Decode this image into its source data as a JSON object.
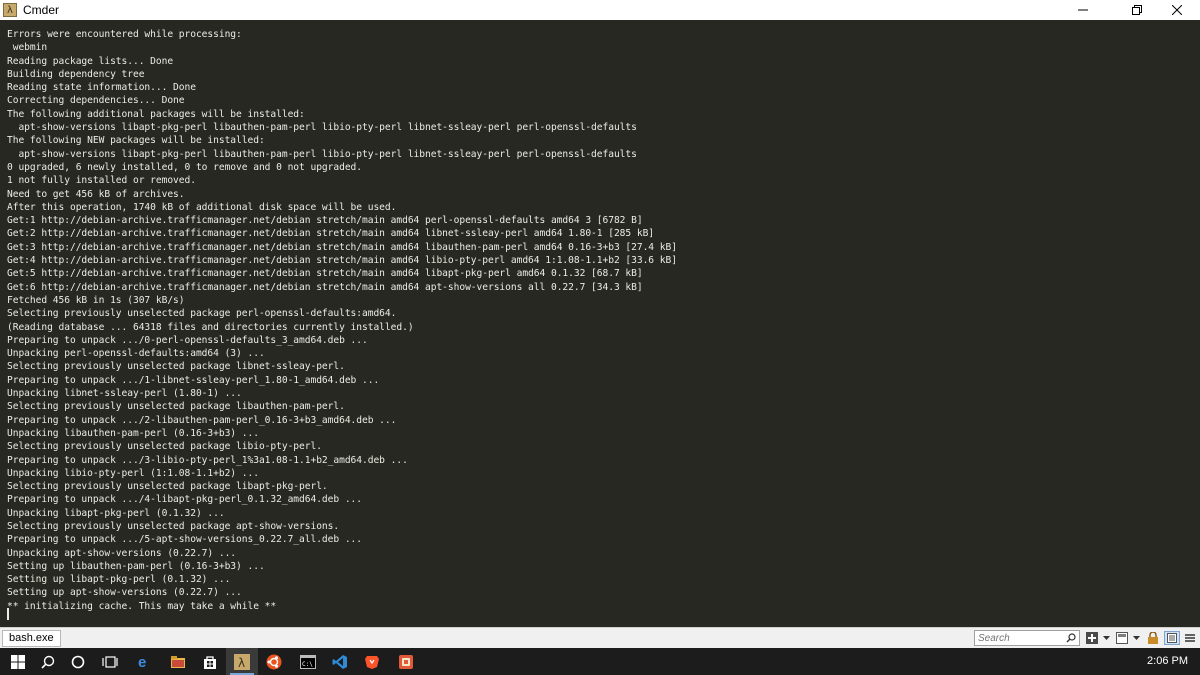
{
  "window": {
    "title": "Cmder",
    "app_icon_glyph": "λ"
  },
  "terminal": {
    "lines": [
      "Errors were encountered while processing:",
      " webmin",
      "Reading package lists... Done",
      "Building dependency tree",
      "Reading state information... Done",
      "Correcting dependencies... Done",
      "The following additional packages will be installed:",
      "  apt-show-versions libapt-pkg-perl libauthen-pam-perl libio-pty-perl libnet-ssleay-perl perl-openssl-defaults",
      "The following NEW packages will be installed:",
      "  apt-show-versions libapt-pkg-perl libauthen-pam-perl libio-pty-perl libnet-ssleay-perl perl-openssl-defaults",
      "0 upgraded, 6 newly installed, 0 to remove and 0 not upgraded.",
      "1 not fully installed or removed.",
      "Need to get 456 kB of archives.",
      "After this operation, 1740 kB of additional disk space will be used.",
      "Get:1 http://debian-archive.trafficmanager.net/debian stretch/main amd64 perl-openssl-defaults amd64 3 [6782 B]",
      "Get:2 http://debian-archive.trafficmanager.net/debian stretch/main amd64 libnet-ssleay-perl amd64 1.80-1 [285 kB]",
      "Get:3 http://debian-archive.trafficmanager.net/debian stretch/main amd64 libauthen-pam-perl amd64 0.16-3+b3 [27.4 kB]",
      "Get:4 http://debian-archive.trafficmanager.net/debian stretch/main amd64 libio-pty-perl amd64 1:1.08-1.1+b2 [33.6 kB]",
      "Get:5 http://debian-archive.trafficmanager.net/debian stretch/main amd64 libapt-pkg-perl amd64 0.1.32 [68.7 kB]",
      "Get:6 http://debian-archive.trafficmanager.net/debian stretch/main amd64 apt-show-versions all 0.22.7 [34.3 kB]",
      "Fetched 456 kB in 1s (307 kB/s)",
      "Selecting previously unselected package perl-openssl-defaults:amd64.",
      "(Reading database ... 64318 files and directories currently installed.)",
      "Preparing to unpack .../0-perl-openssl-defaults_3_amd64.deb ...",
      "Unpacking perl-openssl-defaults:amd64 (3) ...",
      "Selecting previously unselected package libnet-ssleay-perl.",
      "Preparing to unpack .../1-libnet-ssleay-perl_1.80-1_amd64.deb ...",
      "Unpacking libnet-ssleay-perl (1.80-1) ...",
      "Selecting previously unselected package libauthen-pam-perl.",
      "Preparing to unpack .../2-libauthen-pam-perl_0.16-3+b3_amd64.deb ...",
      "Unpacking libauthen-pam-perl (0.16-3+b3) ...",
      "Selecting previously unselected package libio-pty-perl.",
      "Preparing to unpack .../3-libio-pty-perl_1%3a1.08-1.1+b2_amd64.deb ...",
      "Unpacking libio-pty-perl (1:1.08-1.1+b2) ...",
      "Selecting previously unselected package libapt-pkg-perl.",
      "Preparing to unpack .../4-libapt-pkg-perl_0.1.32_amd64.deb ...",
      "Unpacking libapt-pkg-perl (0.1.32) ...",
      "Selecting previously unselected package apt-show-versions.",
      "Preparing to unpack .../5-apt-show-versions_0.22.7_all.deb ...",
      "Unpacking apt-show-versions (0.22.7) ...",
      "Setting up libauthen-pam-perl (0.16-3+b3) ...",
      "Setting up libapt-pkg-perl (0.1.32) ...",
      "Setting up apt-show-versions (0.22.7) ...",
      "** initializing cache. This may take a while **"
    ]
  },
  "cmder_bar": {
    "tab_label": "bash.exe",
    "search_placeholder": "Search"
  },
  "taskbar": {
    "clock": "2:06 PM"
  },
  "colors": {
    "terminal_bg": "#272822",
    "terminal_fg": "#ecece4",
    "taskbar_bg": "#1c1c1c"
  }
}
